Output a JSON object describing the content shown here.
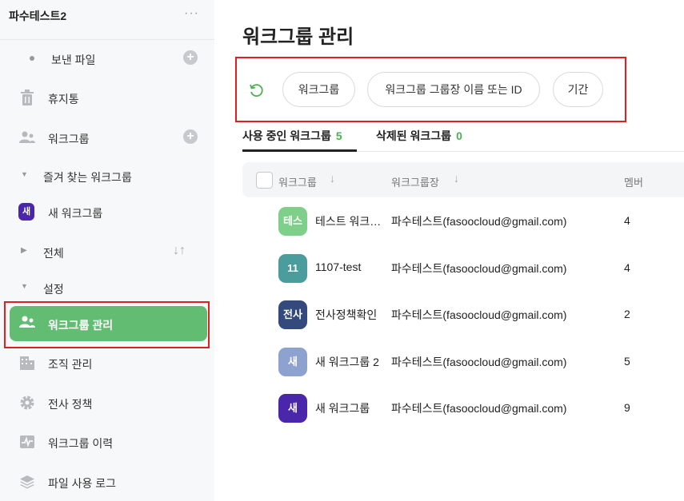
{
  "sidebar": {
    "org_name": "파수테스트2",
    "more": "···",
    "items": {
      "sent_files": "보낸 파일",
      "trash": "휴지통",
      "workgroups": "워크그룹",
      "favorites": "즐겨 찾는 워크그룹",
      "new_workgroup": "새 워크그룹",
      "new_badge": "새",
      "all": "전체",
      "settings": "설정",
      "workgroup_manage": "워크그룹 관리",
      "org_manage": "조직 관리",
      "company_policy": "전사 정책",
      "workgroup_history": "워크그룹 이력",
      "file_usage_log": "파일 사용 로그"
    }
  },
  "main": {
    "title": "워크그룹 관리",
    "filters": [
      "워크그룹",
      "워크그룹 그룹장 이름 또는 ID",
      "기간"
    ],
    "tabs": [
      {
        "label": "사용 중인 워크그룹",
        "count": "5"
      },
      {
        "label": "삭제된 워크그룹",
        "count": "0"
      }
    ],
    "columns": {
      "name": "워크그룹",
      "owner": "워크그룹장",
      "members": "멤버"
    },
    "rows": [
      {
        "avatar": "테스",
        "name": "테스트 워크그룹",
        "owner": "파수테스트(fasoocloud@gmail.com)",
        "members": "4",
        "color": "#7ecf8a"
      },
      {
        "avatar": "11",
        "name": "1107-test",
        "owner": "파수테스트(fasoocloud@gmail.com)",
        "members": "4",
        "color": "#4b9c9c"
      },
      {
        "avatar": "전사",
        "name": "전사정책확인",
        "owner": "파수테스트(fasoocloud@gmail.com)",
        "members": "2",
        "color": "#354a7c"
      },
      {
        "avatar": "새",
        "name": "새 워크그룹 2",
        "owner": "파수테스트(fasoocloud@gmail.com)",
        "members": "5",
        "color": "#8ea2cf"
      },
      {
        "avatar": "새",
        "name": "새 워크그룹",
        "owner": "파수테스트(fasoocloud@gmail.com)",
        "members": "9",
        "color": "#4a26ab"
      }
    ]
  },
  "colors": {
    "accent": "#62bd73",
    "highlight": "#e02020"
  }
}
